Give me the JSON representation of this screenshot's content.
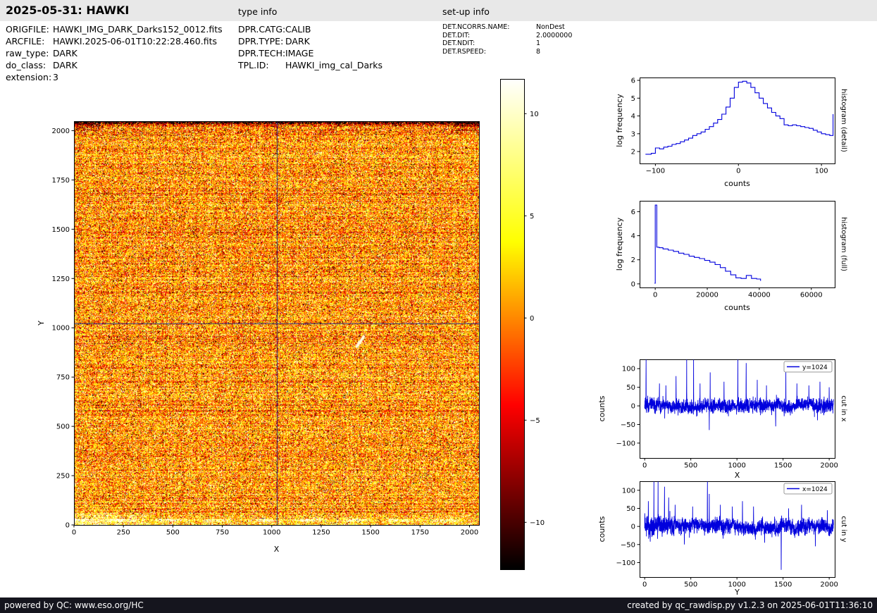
{
  "header": {
    "title": "2025-05-31: HAWKI",
    "type_info_label": "type info",
    "setup_info_label": "set-up info"
  },
  "file_info": {
    "rows": [
      {
        "label": "ORIGFILE:",
        "value": "HAWKI_IMG_DARK_Darks152_0012.fits"
      },
      {
        "label": "ARCFILE:",
        "value": "HAWKI.2025-06-01T10:22:28.460.fits"
      },
      {
        "label": "raw_type:",
        "value": "DARK"
      },
      {
        "label": "do_class:",
        "value": "DARK"
      },
      {
        "label": "extension:",
        "value": "3"
      }
    ]
  },
  "type_info": {
    "rows": [
      {
        "label": "DPR.CATG:",
        "value": "CALIB"
      },
      {
        "label": "DPR.TYPE:",
        "value": "DARK"
      },
      {
        "label": "DPR.TECH:",
        "value": "IMAGE"
      },
      {
        "label": "TPL.ID:",
        "value": "HAWKI_img_cal_Darks"
      }
    ]
  },
  "setup_info": {
    "rows": [
      {
        "label": "DET.NCORRS.NAME:",
        "value": "NonDest"
      },
      {
        "label": "DET.DIT:",
        "value": "2.0000000"
      },
      {
        "label": "DET.NDIT:",
        "value": "1"
      },
      {
        "label": "DET.RSPEED:",
        "value": "8"
      }
    ]
  },
  "footer": {
    "left": "powered by QC: www.eso.org/HC",
    "right": "created by qc_rawdisp.py v1.2.3 on 2025-06-01T11:36:10"
  },
  "colors": {
    "header_bg": "#e8e8e8",
    "footer_bg": "#15151e",
    "footer_text": "#ffffff",
    "plot_line": "#0000dd",
    "crosshair": "#000080"
  },
  "chart_data": [
    {
      "id": "detector-image",
      "type": "heatmap",
      "xlabel": "X",
      "ylabel": "Y",
      "xlim": [
        0,
        2048
      ],
      "ylim": [
        0,
        2048
      ],
      "xticks": [
        0,
        250,
        500,
        750,
        1000,
        1250,
        1500,
        1750,
        2000
      ],
      "yticks": [
        0,
        250,
        500,
        750,
        1000,
        1250,
        1500,
        1750,
        2000
      ],
      "colormap": "hot",
      "vmin": -12.3,
      "vmax": 11.7,
      "crosshair": {
        "x": 1024,
        "y": 1024
      },
      "noise": {
        "mean": 0.8,
        "sigma": 4.4,
        "outlier_fraction": 0.07
      },
      "features": [
        "dark mottled band along top edge",
        "bright rows along bottom edge",
        "small white streak near (1440, 930)",
        "navy crosshair lines at x=1024 and y=1024"
      ]
    },
    {
      "id": "colorbar",
      "type": "colorbar",
      "colormap": "hot",
      "range": [
        -12.3,
        11.7
      ],
      "ticks": [
        10,
        5,
        0,
        -5,
        -10
      ]
    },
    {
      "id": "hist-detail",
      "type": "line",
      "step": true,
      "xlabel": "counts",
      "ylabel": "log frequency",
      "right_label": "histogram (detail)",
      "xlim": [
        -119,
        116
      ],
      "ylim": [
        1.33,
        6.16
      ],
      "xticks": [
        -100,
        0,
        100
      ],
      "yticks": [
        2,
        3,
        4,
        5,
        6
      ],
      "x": [
        -112,
        -105,
        -100,
        -95,
        -90,
        -85,
        -80,
        -75,
        -70,
        -65,
        -60,
        -55,
        -50,
        -45,
        -40,
        -35,
        -30,
        -25,
        -20,
        -15,
        -10,
        -5,
        0,
        5,
        10,
        15,
        20,
        25,
        30,
        35,
        40,
        45,
        50,
        55,
        60,
        65,
        70,
        75,
        80,
        85,
        90,
        95,
        100,
        105,
        110,
        114
      ],
      "y": [
        1.85,
        1.9,
        2.2,
        2.15,
        2.25,
        2.3,
        2.4,
        2.45,
        2.55,
        2.65,
        2.75,
        2.9,
        3.0,
        3.1,
        3.25,
        3.4,
        3.6,
        3.8,
        4.1,
        4.5,
        5.0,
        5.6,
        5.9,
        5.95,
        5.85,
        5.6,
        5.3,
        5.0,
        4.7,
        4.45,
        4.2,
        4.0,
        3.85,
        3.5,
        3.45,
        3.5,
        3.45,
        3.4,
        3.35,
        3.3,
        3.2,
        3.1,
        3.0,
        2.95,
        2.9,
        4.1
      ]
    },
    {
      "id": "hist-full",
      "type": "line",
      "step": true,
      "xlabel": "counts",
      "ylabel": "log frequency",
      "right_label": "histogram (full)",
      "xlim": [
        -6000,
        69000
      ],
      "ylim": [
        -0.3,
        6.9
      ],
      "xticks": [
        0,
        20000,
        40000,
        60000
      ],
      "yticks": [
        0,
        2,
        4,
        6
      ],
      "x": [
        -300,
        0,
        600,
        1500,
        3000,
        5000,
        7000,
        9000,
        11000,
        13000,
        15000,
        17000,
        19000,
        21000,
        23000,
        25000,
        27000,
        29000,
        31000,
        33000,
        35000,
        37000,
        39000,
        40500
      ],
      "y": [
        0.05,
        6.55,
        3.05,
        3.0,
        2.9,
        2.8,
        2.7,
        2.55,
        2.45,
        2.3,
        2.2,
        2.1,
        1.95,
        1.8,
        1.6,
        1.35,
        1.05,
        0.75,
        0.5,
        0.45,
        0.7,
        0.45,
        0.4,
        0.25
      ]
    },
    {
      "id": "cut-x",
      "type": "line",
      "xlabel": "X",
      "ylabel": "counts",
      "right_label": "cut in x",
      "legend": "y=1024",
      "xlim": [
        -55,
        2060
      ],
      "ylim": [
        -140,
        125
      ],
      "xticks": [
        0,
        500,
        1000,
        1500,
        2000
      ],
      "yticks": [
        -100,
        -50,
        0,
        50,
        100
      ],
      "noise": {
        "baseline": 0,
        "sigma": 11,
        "n": 2048
      },
      "spikes": [
        {
          "x": 15,
          "y": 124
        },
        {
          "x": 160,
          "y": 60
        },
        {
          "x": 230,
          "y": 55
        },
        {
          "x": 340,
          "y": 80
        },
        {
          "x": 455,
          "y": 124
        },
        {
          "x": 530,
          "y": 124
        },
        {
          "x": 600,
          "y": 60
        },
        {
          "x": 700,
          "y": -65
        },
        {
          "x": 710,
          "y": 90
        },
        {
          "x": 860,
          "y": 65
        },
        {
          "x": 1010,
          "y": 124
        },
        {
          "x": 1100,
          "y": 115
        },
        {
          "x": 1220,
          "y": 70
        },
        {
          "x": 1320,
          "y": 55
        },
        {
          "x": 1420,
          "y": -55
        },
        {
          "x": 1530,
          "y": 95
        },
        {
          "x": 1650,
          "y": 60
        },
        {
          "x": 1780,
          "y": 55
        },
        {
          "x": 1900,
          "y": 65
        },
        {
          "x": 2000,
          "y": 50
        }
      ]
    },
    {
      "id": "cut-y",
      "type": "line",
      "xlabel": "Y",
      "ylabel": "counts",
      "right_label": "cut in y",
      "legend": "x=1024",
      "xlim": [
        -55,
        2060
      ],
      "ylim": [
        -140,
        125
      ],
      "xticks": [
        0,
        500,
        1000,
        1500,
        2000
      ],
      "yticks": [
        -100,
        -50,
        0,
        50,
        100
      ],
      "noise": {
        "baseline": 0,
        "sigma": 11,
        "n": 2048,
        "burst": {
          "until": 320,
          "sigma": 17
        }
      },
      "spikes": [
        {
          "x": 40,
          "y": 70
        },
        {
          "x": 100,
          "y": 124
        },
        {
          "x": 145,
          "y": 124
        },
        {
          "x": 215,
          "y": 110
        },
        {
          "x": 260,
          "y": 80
        },
        {
          "x": 330,
          "y": 60
        },
        {
          "x": 430,
          "y": -50
        },
        {
          "x": 520,
          "y": 55
        },
        {
          "x": 680,
          "y": 124
        },
        {
          "x": 700,
          "y": 90
        },
        {
          "x": 820,
          "y": 60
        },
        {
          "x": 950,
          "y": 55
        },
        {
          "x": 1060,
          "y": 70
        },
        {
          "x": 1180,
          "y": 55
        },
        {
          "x": 1300,
          "y": -45
        },
        {
          "x": 1480,
          "y": -120
        },
        {
          "x": 1560,
          "y": 50
        },
        {
          "x": 1700,
          "y": 60
        },
        {
          "x": 1850,
          "y": -55
        },
        {
          "x": 1980,
          "y": 45
        }
      ]
    }
  ]
}
